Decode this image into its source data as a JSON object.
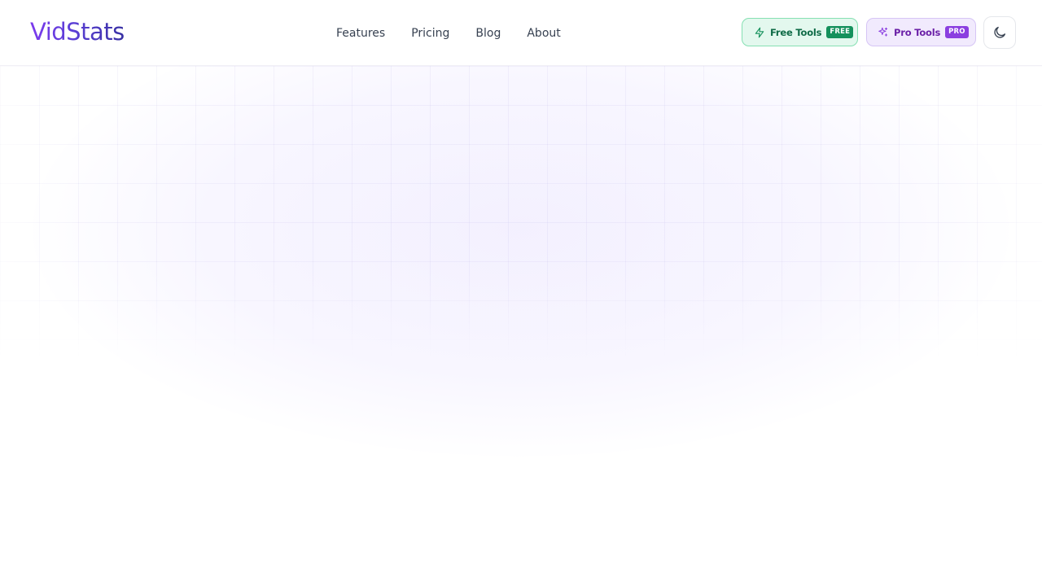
{
  "brand": {
    "name": "VidStats"
  },
  "nav": {
    "items": [
      {
        "label": "Features"
      },
      {
        "label": "Pricing"
      },
      {
        "label": "Blog"
      },
      {
        "label": "About"
      }
    ]
  },
  "actions": {
    "free_tools": {
      "label": "Free Tools",
      "badge": "FREE",
      "icon": "lightning-icon"
    },
    "pro_tools": {
      "label": "Pro Tools",
      "badge": "PRO",
      "icon": "sparkles-icon"
    },
    "theme_toggle": {
      "icon": "moon-icon"
    }
  },
  "colors": {
    "brand_gradient_start": "#7c3aed",
    "brand_gradient_end": "#3730a3",
    "free_accent": "#15915c",
    "pro_accent": "#8b3fe0"
  }
}
